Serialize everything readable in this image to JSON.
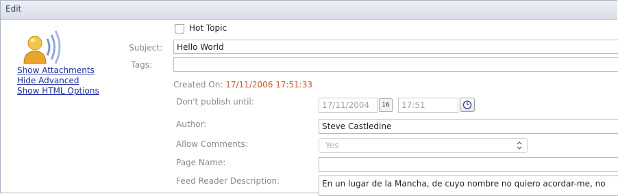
{
  "titlebar": {
    "title": "Edit"
  },
  "sidebar_links": {
    "show_attachments": "Show Attachments",
    "hide_advanced": "Hide Advanced",
    "show_html_options": "Show HTML Options"
  },
  "hot_topic": {
    "label": "Hot Topic",
    "checked": false
  },
  "subject": {
    "label": "Subject:",
    "value": "Hello World"
  },
  "tags": {
    "label": "Tags:",
    "value": ""
  },
  "created_on": {
    "label": "Created On:",
    "value": "17/11/2006 17:51:33"
  },
  "publish_until": {
    "label": "Don't publish until:",
    "date": "17/11/2004",
    "calendar_icon_text": "16",
    "time": "17:51"
  },
  "author": {
    "label": "Author:",
    "value": "Steve Castledine"
  },
  "allow_comments": {
    "label": "Allow Comments:",
    "selected": "Yes"
  },
  "page_name": {
    "label": "Page Name:",
    "value": ""
  },
  "feed_reader_description": {
    "label": "Feed Reader Description:",
    "value": "En un lugar de la Mancha, de cuyo nombre no quiero acordar-me, no"
  },
  "colors": {
    "link": "#1c2a9e",
    "created_value": "#d05a2a",
    "label": "#8a8a8a"
  }
}
